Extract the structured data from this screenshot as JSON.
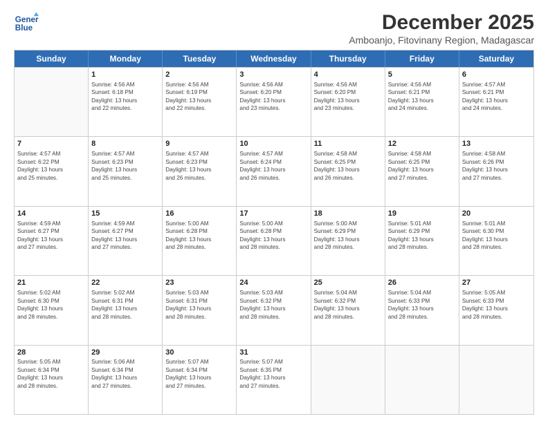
{
  "logo": {
    "line1": "General",
    "line2": "Blue"
  },
  "title": "December 2025",
  "subtitle": "Amboanjo, Fitovinany Region, Madagascar",
  "days_of_week": [
    "Sunday",
    "Monday",
    "Tuesday",
    "Wednesday",
    "Thursday",
    "Friday",
    "Saturday"
  ],
  "weeks": [
    [
      {
        "day": "",
        "info": ""
      },
      {
        "day": "1",
        "info": "Sunrise: 4:56 AM\nSunset: 6:18 PM\nDaylight: 13 hours\nand 22 minutes."
      },
      {
        "day": "2",
        "info": "Sunrise: 4:56 AM\nSunset: 6:19 PM\nDaylight: 13 hours\nand 22 minutes."
      },
      {
        "day": "3",
        "info": "Sunrise: 4:56 AM\nSunset: 6:20 PM\nDaylight: 13 hours\nand 23 minutes."
      },
      {
        "day": "4",
        "info": "Sunrise: 4:56 AM\nSunset: 6:20 PM\nDaylight: 13 hours\nand 23 minutes."
      },
      {
        "day": "5",
        "info": "Sunrise: 4:56 AM\nSunset: 6:21 PM\nDaylight: 13 hours\nand 24 minutes."
      },
      {
        "day": "6",
        "info": "Sunrise: 4:57 AM\nSunset: 6:21 PM\nDaylight: 13 hours\nand 24 minutes."
      }
    ],
    [
      {
        "day": "7",
        "info": "Sunrise: 4:57 AM\nSunset: 6:22 PM\nDaylight: 13 hours\nand 25 minutes."
      },
      {
        "day": "8",
        "info": "Sunrise: 4:57 AM\nSunset: 6:23 PM\nDaylight: 13 hours\nand 25 minutes."
      },
      {
        "day": "9",
        "info": "Sunrise: 4:57 AM\nSunset: 6:23 PM\nDaylight: 13 hours\nand 26 minutes."
      },
      {
        "day": "10",
        "info": "Sunrise: 4:57 AM\nSunset: 6:24 PM\nDaylight: 13 hours\nand 26 minutes."
      },
      {
        "day": "11",
        "info": "Sunrise: 4:58 AM\nSunset: 6:25 PM\nDaylight: 13 hours\nand 26 minutes."
      },
      {
        "day": "12",
        "info": "Sunrise: 4:58 AM\nSunset: 6:25 PM\nDaylight: 13 hours\nand 27 minutes."
      },
      {
        "day": "13",
        "info": "Sunrise: 4:58 AM\nSunset: 6:26 PM\nDaylight: 13 hours\nand 27 minutes."
      }
    ],
    [
      {
        "day": "14",
        "info": "Sunrise: 4:59 AM\nSunset: 6:27 PM\nDaylight: 13 hours\nand 27 minutes."
      },
      {
        "day": "15",
        "info": "Sunrise: 4:59 AM\nSunset: 6:27 PM\nDaylight: 13 hours\nand 27 minutes."
      },
      {
        "day": "16",
        "info": "Sunrise: 5:00 AM\nSunset: 6:28 PM\nDaylight: 13 hours\nand 28 minutes."
      },
      {
        "day": "17",
        "info": "Sunrise: 5:00 AM\nSunset: 6:28 PM\nDaylight: 13 hours\nand 28 minutes."
      },
      {
        "day": "18",
        "info": "Sunrise: 5:00 AM\nSunset: 6:29 PM\nDaylight: 13 hours\nand 28 minutes."
      },
      {
        "day": "19",
        "info": "Sunrise: 5:01 AM\nSunset: 6:29 PM\nDaylight: 13 hours\nand 28 minutes."
      },
      {
        "day": "20",
        "info": "Sunrise: 5:01 AM\nSunset: 6:30 PM\nDaylight: 13 hours\nand 28 minutes."
      }
    ],
    [
      {
        "day": "21",
        "info": "Sunrise: 5:02 AM\nSunset: 6:30 PM\nDaylight: 13 hours\nand 28 minutes."
      },
      {
        "day": "22",
        "info": "Sunrise: 5:02 AM\nSunset: 6:31 PM\nDaylight: 13 hours\nand 28 minutes."
      },
      {
        "day": "23",
        "info": "Sunrise: 5:03 AM\nSunset: 6:31 PM\nDaylight: 13 hours\nand 28 minutes."
      },
      {
        "day": "24",
        "info": "Sunrise: 5:03 AM\nSunset: 6:32 PM\nDaylight: 13 hours\nand 28 minutes."
      },
      {
        "day": "25",
        "info": "Sunrise: 5:04 AM\nSunset: 6:32 PM\nDaylight: 13 hours\nand 28 minutes."
      },
      {
        "day": "26",
        "info": "Sunrise: 5:04 AM\nSunset: 6:33 PM\nDaylight: 13 hours\nand 28 minutes."
      },
      {
        "day": "27",
        "info": "Sunrise: 5:05 AM\nSunset: 6:33 PM\nDaylight: 13 hours\nand 28 minutes."
      }
    ],
    [
      {
        "day": "28",
        "info": "Sunrise: 5:05 AM\nSunset: 6:34 PM\nDaylight: 13 hours\nand 28 minutes."
      },
      {
        "day": "29",
        "info": "Sunrise: 5:06 AM\nSunset: 6:34 PM\nDaylight: 13 hours\nand 27 minutes."
      },
      {
        "day": "30",
        "info": "Sunrise: 5:07 AM\nSunset: 6:34 PM\nDaylight: 13 hours\nand 27 minutes."
      },
      {
        "day": "31",
        "info": "Sunrise: 5:07 AM\nSunset: 6:35 PM\nDaylight: 13 hours\nand 27 minutes."
      },
      {
        "day": "",
        "info": ""
      },
      {
        "day": "",
        "info": ""
      },
      {
        "day": "",
        "info": ""
      }
    ]
  ]
}
